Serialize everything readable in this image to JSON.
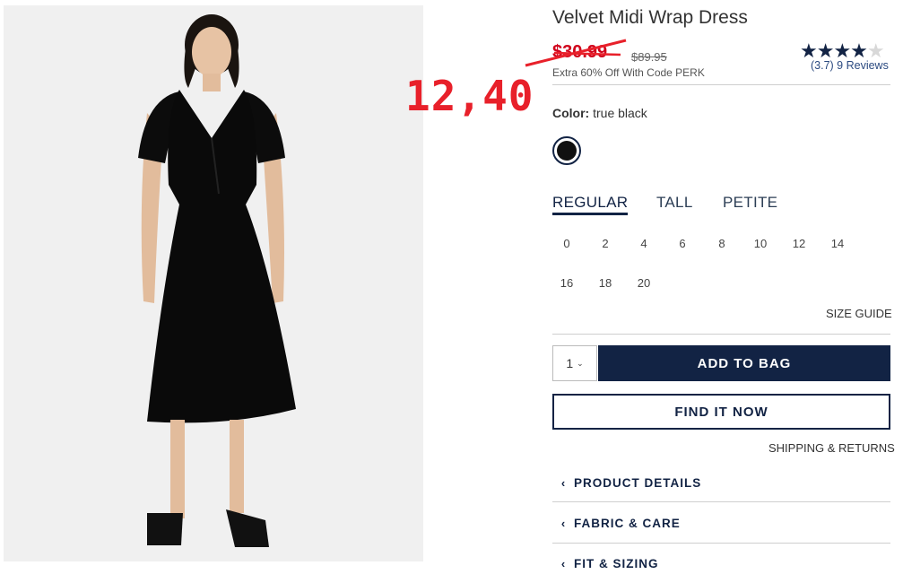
{
  "product": {
    "title": "Velvet Midi Wrap Dress",
    "sale_price": "$30.99",
    "original_price": "$89.95",
    "promo": "Extra 60% Off With Code PERK",
    "rating_stars": "★★★★",
    "rating": 3.7,
    "reviews_label": "(3.7) 9 Reviews",
    "annotation": "12,40"
  },
  "color": {
    "label": "Color:",
    "value": "true black",
    "swatch_hex": "#111111"
  },
  "fits": [
    {
      "label": "REGULAR",
      "active": true
    },
    {
      "label": "TALL",
      "active": false
    },
    {
      "label": "PETITE",
      "active": false
    }
  ],
  "sizes": [
    "0",
    "2",
    "4",
    "6",
    "8",
    "10",
    "12",
    "14",
    "16",
    "18",
    "20"
  ],
  "size_guide": "SIZE GUIDE",
  "purchase": {
    "quantity": "1",
    "add_to_bag": "ADD TO BAG",
    "find_it_now": "FIND IT NOW",
    "shipping_returns": "SHIPPING & RETURNS"
  },
  "accordion": [
    {
      "label": "PRODUCT DETAILS"
    },
    {
      "label": "FABRIC & CARE"
    },
    {
      "label": "FIT & SIZING"
    }
  ],
  "colors": {
    "brand_navy": "#122344",
    "sale_red": "#d0021b",
    "annotation_red": "#e8202a"
  }
}
